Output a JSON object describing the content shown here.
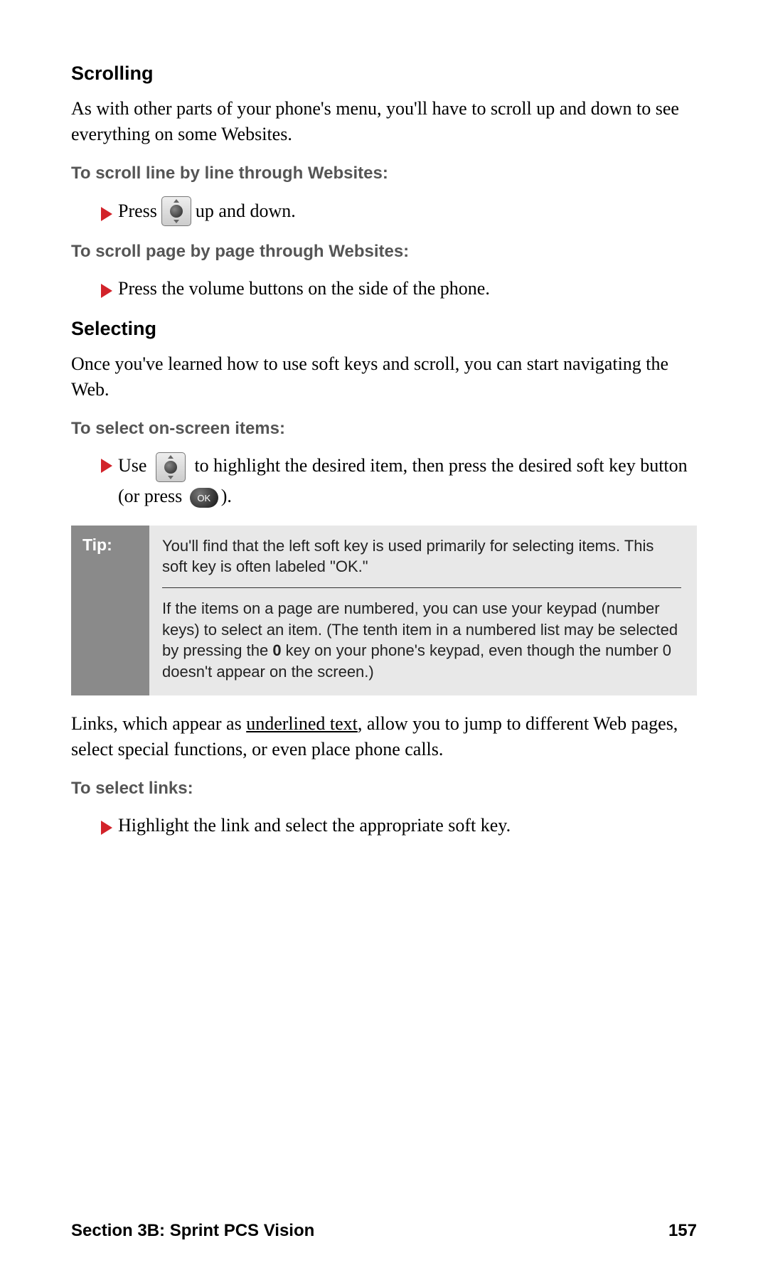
{
  "s1": {
    "head": "Scrolling",
    "intro": "As with other parts of your phone's menu, you'll have to scroll up and down to see everything on some Websites.",
    "sub1": "To scroll line by line through Websites:",
    "b1a": "Press",
    "b1b": "up and down.",
    "sub2": "To scroll page by page through Websites:",
    "b2": "Press the volume buttons on the side of the phone."
  },
  "s2": {
    "head": "Selecting",
    "intro": "Once you've learned how to use soft keys and scroll, you can start navigating the Web.",
    "sub1": "To select on-screen items:",
    "b1a": "Use",
    "b1b": "to highlight the desired item, then press the desired soft key button (or press",
    "b1c": ").",
    "ok": "OK",
    "links_a": "Links, which appear as ",
    "links_u": "underlined text",
    "links_b": ", allow you to jump to different Web pages, select special functions, or even place phone calls.",
    "sub2": "To select links:",
    "b2": "Highlight the link and select the appropriate soft key."
  },
  "tip": {
    "label": "Tip:",
    "p1": "You'll find that the left soft key is used primarily for selecting items. This soft key is often labeled \"OK.\"",
    "p2a": "If the items on a page are numbered, you can use your keypad (number keys) to select an item. (The tenth item in a numbered list may be selected by pressing the ",
    "p2b": "0",
    "p2c": " key on your phone's keypad, even though the number 0 doesn't appear on the screen.)"
  },
  "footer": {
    "left": "Section 3B: Sprint PCS Vision",
    "page": "157"
  }
}
